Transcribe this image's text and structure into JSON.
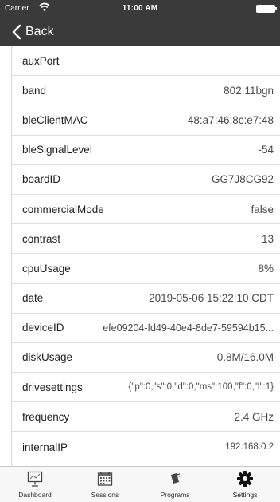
{
  "status": {
    "carrier": "Carrier",
    "time": "11:00 AM"
  },
  "nav": {
    "back_label": "Back"
  },
  "rows": [
    {
      "key": "auxPort",
      "value": ""
    },
    {
      "key": "band",
      "value": "802.11bgn"
    },
    {
      "key": "bleClientMAC",
      "value": "48:a7:46:8c:e7:48"
    },
    {
      "key": "bleSignalLevel",
      "value": "-54"
    },
    {
      "key": "boardID",
      "value": "GG7J8CG92"
    },
    {
      "key": "commercialMode",
      "value": "false"
    },
    {
      "key": "contrast",
      "value": "13"
    },
    {
      "key": "cpuUsage",
      "value": "8%"
    },
    {
      "key": "date",
      "value": "2019-05-06 15:22:10 CDT"
    },
    {
      "key": "deviceID",
      "value": "efe09204-fd49-40e4-8de7-59594b15..."
    },
    {
      "key": "diskUsage",
      "value": "0.8M/16.0M"
    },
    {
      "key": "drivesettings",
      "value": "{\"p\":0,\"s\":0,\"d\":0,\"ms\":100,\"f\":0,\"l\":1}"
    },
    {
      "key": "frequency",
      "value": "2.4 GHz"
    },
    {
      "key": "internalIP",
      "value": "192.168.0.2"
    }
  ],
  "tabs": [
    {
      "label": "Dashboard",
      "icon": "dashboard-icon"
    },
    {
      "label": "Sessions",
      "icon": "calendar-icon"
    },
    {
      "label": "Programs",
      "icon": "programs-icon"
    },
    {
      "label": "Settings",
      "icon": "gear-icon",
      "active": true
    }
  ],
  "colors": {
    "bar": "#3a3a3a",
    "tabbar": "#f7f7f7"
  }
}
